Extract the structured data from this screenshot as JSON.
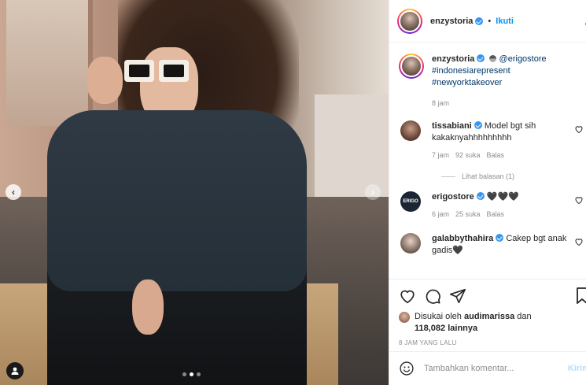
{
  "post": {
    "image_dots": 3,
    "active_dot": 1
  },
  "header": {
    "username": "enzystoria",
    "separator": "•",
    "follow_label": "Ikuti",
    "more_label": "·"
  },
  "caption": {
    "username": "enzystoria",
    "mention": "@erigostore",
    "hashtag1": "#indonesiarepresent",
    "hashtag2": "#newyorktakeover",
    "time": "8 jam"
  },
  "comments": [
    {
      "username": "tissabiani",
      "text": "Model bgt sih kakaknyahhhhhhhhh",
      "time": "7 jam",
      "likes": "92 suka",
      "reply": "Balas",
      "view_replies": "Lihat balasan (1)"
    },
    {
      "username": "erigostore",
      "text": "🖤🖤🖤",
      "time": "6 jam",
      "likes": "25 suka",
      "reply": "Balas"
    },
    {
      "username": "galabbythahira",
      "text": "Cakep bgt anak gadis🖤"
    }
  ],
  "likes": {
    "prefix": "Disukai oleh",
    "user": "audimarissa",
    "and": "dan",
    "count": "118,082 lainnya"
  },
  "timestamp": "8 JAM YANG LALU",
  "composer": {
    "placeholder": "Tambahkan komentar...",
    "send_label": "Kirim"
  },
  "colors": {
    "accent": "#0095f6",
    "verified": "#3897f0",
    "hashtag": "#00376b",
    "muted": "#8e8e8e"
  }
}
